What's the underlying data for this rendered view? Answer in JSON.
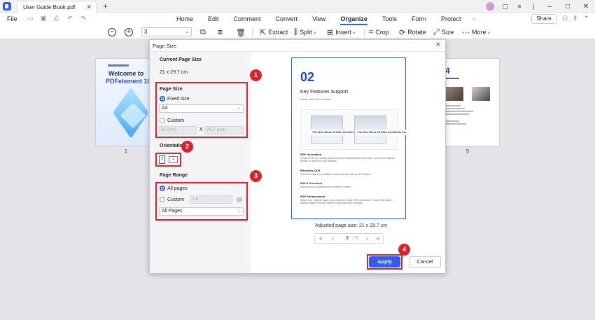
{
  "titlebar": {
    "tab_title": "User Guide Book.pdf",
    "close_glyph": "✕",
    "new_tab_glyph": "+"
  },
  "menubar": {
    "file": "File",
    "items": [
      "Home",
      "Edit",
      "Comment",
      "Convert",
      "View",
      "Organize",
      "Tools",
      "Form",
      "Protect"
    ],
    "active": "Organize",
    "share": "Share"
  },
  "toolbar": {
    "page_value": "3",
    "extract": "Extract",
    "split": "Split",
    "insert": "Insert",
    "crop": "Crop",
    "rotate": "Rotate",
    "size": "Size",
    "more": "More"
  },
  "thumbnails": {
    "page1": {
      "line1": "Welcome to",
      "line2": "PDFelement 10",
      "label": "1"
    },
    "page5": {
      "number": "4",
      "label": "5"
    }
  },
  "dialog": {
    "title": "Page Size",
    "close_glyph": "✕",
    "current_size_heading": "Current Page Size",
    "current_size_value": "21 x 29.7 cm",
    "page_size_heading": "Page Size",
    "fixed_size_label": "Fixed size",
    "fixed_size_value": "A4",
    "custom_label": "Custom",
    "custom_width": "21 (cm)",
    "custom_x": "X",
    "custom_height": "29.7 (cm)",
    "orientation_heading": "Orientation",
    "page_range_heading": "Page Range",
    "all_pages_label": "All pages",
    "range_custom_label": "Custom",
    "range_custom_value": "1-5",
    "range_subset_value": "All Pages",
    "preview": {
      "number": "02",
      "title": "Key Features Support",
      "subtitle": "Create, edit, OCR & convert.",
      "shot_caption": "The New Work Of Kian Architects Inc.",
      "sections": [
        {
          "heading": "PDF Generation",
          "text": "Create a PDF from scratch, upload from the Template Mall or Cloud store, convert from different formats, or open from your clipboard."
        },
        {
          "heading": "Effortless OCR",
          "text": "Transform images into editable or searchable text with our OCR feature."
        },
        {
          "heading": "Edit & Comment",
          "text": "Use edit tool or comment tool to modify the content."
        },
        {
          "heading": "PDF Enhancement",
          "text": "Merge, crop, organize pages, and compress for peak PDF performance. Convert with ease to various formats. Premium members enjoy enhanced privileges."
        }
      ]
    },
    "adjusted_label": "Adjusted page size: 21 x 29.7 cm",
    "pager": {
      "first": "«",
      "prev": "‹",
      "current": "3",
      "total": "/ 5",
      "next": "›",
      "last": "»"
    },
    "apply": "Apply",
    "cancel": "Cancel"
  },
  "badges": [
    "1",
    "2",
    "3",
    "4"
  ],
  "colors": {
    "accent": "#2d5cf6",
    "highlight_red": "#d8232a"
  },
  "icons": [
    "app-logo-icon",
    "zoom-out-icon",
    "zoom-in-icon",
    "delete-icon",
    "extract-icon",
    "split-icon",
    "insert-icon",
    "crop-icon",
    "rotate-icon",
    "size-icon",
    "more-icon"
  ]
}
